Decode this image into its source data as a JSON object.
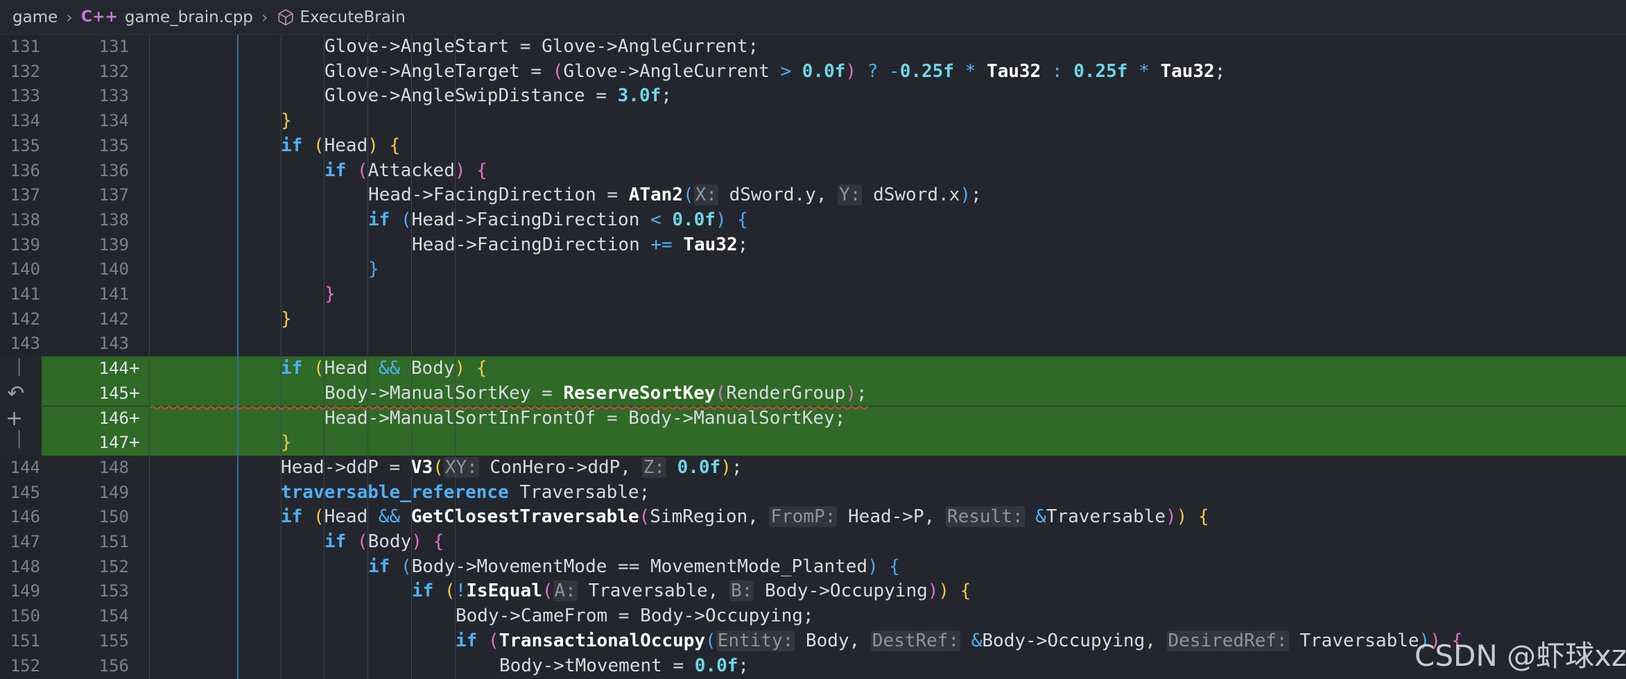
{
  "breadcrumb": {
    "folder": "game",
    "file_icon": "cpp-file-icon",
    "file": "game_brain.cpp",
    "symbol_icon": "cube-symbol-icon",
    "symbol": "ExecuteBrain"
  },
  "lines": [
    {
      "old": "131",
      "new": "131",
      "mark": "",
      "added": false
    },
    {
      "old": "132",
      "new": "132",
      "mark": "",
      "added": false
    },
    {
      "old": "133",
      "new": "133",
      "mark": "",
      "added": false
    },
    {
      "old": "134",
      "new": "134",
      "mark": "",
      "added": false
    },
    {
      "old": "135",
      "new": "135",
      "mark": "",
      "added": false
    },
    {
      "old": "136",
      "new": "136",
      "mark": "",
      "added": false
    },
    {
      "old": "137",
      "new": "137",
      "mark": "",
      "added": false
    },
    {
      "old": "138",
      "new": "138",
      "mark": "",
      "added": false
    },
    {
      "old": "139",
      "new": "139",
      "mark": "",
      "added": false
    },
    {
      "old": "140",
      "new": "140",
      "mark": "",
      "added": false
    },
    {
      "old": "141",
      "new": "141",
      "mark": "",
      "added": false
    },
    {
      "old": "142",
      "new": "142",
      "mark": "",
      "added": false
    },
    {
      "old": "143",
      "new": "143",
      "mark": "",
      "added": false
    },
    {
      "old": "",
      "new": "144",
      "mark": "+",
      "added": true
    },
    {
      "old": "",
      "new": "145",
      "mark": "+",
      "added": true
    },
    {
      "old": "",
      "new": "146",
      "mark": "+",
      "added": true
    },
    {
      "old": "",
      "new": "147",
      "mark": "+",
      "added": true
    },
    {
      "old": "144",
      "new": "148",
      "mark": "",
      "added": false
    },
    {
      "old": "145",
      "new": "149",
      "mark": "",
      "added": false
    },
    {
      "old": "146",
      "new": "150",
      "mark": "",
      "added": false
    },
    {
      "old": "147",
      "new": "151",
      "mark": "",
      "added": false
    },
    {
      "old": "148",
      "new": "152",
      "mark": "",
      "added": false
    },
    {
      "old": "149",
      "new": "153",
      "mark": "",
      "added": false
    },
    {
      "old": "150",
      "new": "154",
      "mark": "",
      "added": false
    },
    {
      "old": "151",
      "new": "155",
      "mark": "",
      "added": false
    },
    {
      "old": "152",
      "new": "156",
      "mark": "",
      "added": false
    }
  ],
  "code": [
    [
      {
        "t": "Glove->AngleStart = Glove->AngleCurrent;",
        "c": ""
      }
    ],
    [
      {
        "t": "Glove->AngleTarget = ",
        "c": ""
      },
      {
        "t": "(",
        "c": "b2"
      },
      {
        "t": "Glove->AngleCurrent ",
        "c": ""
      },
      {
        "t": ">",
        "c": "op"
      },
      {
        "t": " ",
        "c": ""
      },
      {
        "t": "0.0f",
        "c": "num"
      },
      {
        "t": ")",
        "c": "b2"
      },
      {
        "t": " ? -",
        "c": "op"
      },
      {
        "t": "0.25f",
        "c": "num"
      },
      {
        "t": " * ",
        "c": "op"
      },
      {
        "t": "Tau32",
        "c": "fn"
      },
      {
        "t": " : ",
        "c": "op"
      },
      {
        "t": "0.25f",
        "c": "num"
      },
      {
        "t": " * ",
        "c": "op"
      },
      {
        "t": "Tau32",
        "c": "fn"
      },
      {
        "t": ";",
        "c": ""
      }
    ],
    [
      {
        "t": "Glove->AngleSwipDistance = ",
        "c": ""
      },
      {
        "t": "3.0f",
        "c": "num"
      },
      {
        "t": ";",
        "c": ""
      }
    ],
    [
      {
        "t": "}",
        "c": "b1"
      }
    ],
    [
      {
        "t": "if",
        "c": "kw"
      },
      {
        "t": " ",
        "c": ""
      },
      {
        "t": "(",
        "c": "b1"
      },
      {
        "t": "Head",
        "c": ""
      },
      {
        "t": ")",
        "c": "b1"
      },
      {
        "t": " ",
        "c": ""
      },
      {
        "t": "{",
        "c": "b1"
      }
    ],
    [
      {
        "t": "if",
        "c": "kw"
      },
      {
        "t": " ",
        "c": ""
      },
      {
        "t": "(",
        "c": "b2"
      },
      {
        "t": "Attacked",
        "c": ""
      },
      {
        "t": ")",
        "c": "b2"
      },
      {
        "t": " ",
        "c": ""
      },
      {
        "t": "{",
        "c": "b2"
      }
    ],
    [
      {
        "t": "Head->FacingDirection = ",
        "c": ""
      },
      {
        "t": "ATan2",
        "c": "fn"
      },
      {
        "t": "(",
        "c": "b3"
      },
      {
        "t": "X:",
        "c": "hint"
      },
      {
        "t": " dSword.y, ",
        "c": ""
      },
      {
        "t": "Y:",
        "c": "hint"
      },
      {
        "t": " dSword.x",
        "c": ""
      },
      {
        "t": ")",
        "c": "b3"
      },
      {
        "t": ";",
        "c": ""
      }
    ],
    [
      {
        "t": "if",
        "c": "kw"
      },
      {
        "t": " ",
        "c": ""
      },
      {
        "t": "(",
        "c": "b3"
      },
      {
        "t": "Head->FacingDirection ",
        "c": ""
      },
      {
        "t": "<",
        "c": "op"
      },
      {
        "t": " ",
        "c": ""
      },
      {
        "t": "0.0f",
        "c": "num"
      },
      {
        "t": ")",
        "c": "b3"
      },
      {
        "t": " ",
        "c": ""
      },
      {
        "t": "{",
        "c": "b3"
      }
    ],
    [
      {
        "t": "Head->FacingDirection ",
        "c": ""
      },
      {
        "t": "+=",
        "c": "op"
      },
      {
        "t": " ",
        "c": ""
      },
      {
        "t": "Tau32",
        "c": "fn"
      },
      {
        "t": ";",
        "c": ""
      }
    ],
    [
      {
        "t": "}",
        "c": "b3"
      }
    ],
    [
      {
        "t": "}",
        "c": "b2"
      }
    ],
    [
      {
        "t": "}",
        "c": "b1"
      }
    ],
    [],
    [
      {
        "t": "if",
        "c": "kw"
      },
      {
        "t": " ",
        "c": ""
      },
      {
        "t": "(",
        "c": "b1"
      },
      {
        "t": "Head ",
        "c": ""
      },
      {
        "t": "&&",
        "c": "op"
      },
      {
        "t": " Body",
        "c": ""
      },
      {
        "t": ")",
        "c": "b1"
      },
      {
        "t": " ",
        "c": ""
      },
      {
        "t": "{",
        "c": "b1"
      }
    ],
    [
      {
        "t": "Body->ManualSortKey = ",
        "c": ""
      },
      {
        "t": "ReserveSortKey",
        "c": "fn"
      },
      {
        "t": "(",
        "c": "b2"
      },
      {
        "t": "RenderGroup",
        "c": ""
      },
      {
        "t": ")",
        "c": "b2"
      },
      {
        "t": ";",
        "c": ""
      }
    ],
    [
      {
        "t": "Head->ManualSortInFrontOf = Body->ManualSortKey;",
        "c": ""
      }
    ],
    [
      {
        "t": "}",
        "c": "b1"
      }
    ],
    [
      {
        "t": "Head->ddP = ",
        "c": ""
      },
      {
        "t": "V3",
        "c": "fn"
      },
      {
        "t": "(",
        "c": "b1"
      },
      {
        "t": "XY:",
        "c": "hint"
      },
      {
        "t": " ConHero->ddP, ",
        "c": ""
      },
      {
        "t": "Z:",
        "c": "hint"
      },
      {
        "t": " ",
        "c": ""
      },
      {
        "t": "0.0f",
        "c": "num"
      },
      {
        "t": ")",
        "c": "b1"
      },
      {
        "t": ";",
        "c": ""
      }
    ],
    [
      {
        "t": "traversable_reference",
        "c": "ty"
      },
      {
        "t": " Traversable;",
        "c": ""
      }
    ],
    [
      {
        "t": "if",
        "c": "kw"
      },
      {
        "t": " ",
        "c": ""
      },
      {
        "t": "(",
        "c": "b1"
      },
      {
        "t": "Head ",
        "c": ""
      },
      {
        "t": "&&",
        "c": "op"
      },
      {
        "t": " ",
        "c": ""
      },
      {
        "t": "GetClosestTraversable",
        "c": "fn"
      },
      {
        "t": "(",
        "c": "b2"
      },
      {
        "t": "SimRegion, ",
        "c": ""
      },
      {
        "t": "FromP:",
        "c": "hint"
      },
      {
        "t": " Head->P, ",
        "c": ""
      },
      {
        "t": "Result:",
        "c": "hint"
      },
      {
        "t": " ",
        "c": ""
      },
      {
        "t": "&",
        "c": "op"
      },
      {
        "t": "Traversable",
        "c": ""
      },
      {
        "t": ")",
        "c": "b2"
      },
      {
        "t": ")",
        "c": "b1"
      },
      {
        "t": " ",
        "c": ""
      },
      {
        "t": "{",
        "c": "b1"
      }
    ],
    [
      {
        "t": "if",
        "c": "kw"
      },
      {
        "t": " ",
        "c": ""
      },
      {
        "t": "(",
        "c": "b2"
      },
      {
        "t": "Body",
        "c": ""
      },
      {
        "t": ")",
        "c": "b2"
      },
      {
        "t": " ",
        "c": ""
      },
      {
        "t": "{",
        "c": "b2"
      }
    ],
    [
      {
        "t": "if",
        "c": "kw"
      },
      {
        "t": " ",
        "c": ""
      },
      {
        "t": "(",
        "c": "b3"
      },
      {
        "t": "Body->MovementMode == MovementMode_Planted",
        "c": ""
      },
      {
        "t": ")",
        "c": "b3"
      },
      {
        "t": " ",
        "c": ""
      },
      {
        "t": "{",
        "c": "b3"
      }
    ],
    [
      {
        "t": "if",
        "c": "kw"
      },
      {
        "t": " ",
        "c": ""
      },
      {
        "t": "(",
        "c": "b1"
      },
      {
        "t": "!",
        "c": "op"
      },
      {
        "t": "IsEqual",
        "c": "fn"
      },
      {
        "t": "(",
        "c": "b2"
      },
      {
        "t": "A:",
        "c": "hint"
      },
      {
        "t": " Traversable, ",
        "c": ""
      },
      {
        "t": "B:",
        "c": "hint"
      },
      {
        "t": " Body->Occupying",
        "c": ""
      },
      {
        "t": ")",
        "c": "b2"
      },
      {
        "t": ")",
        "c": "b1"
      },
      {
        "t": " ",
        "c": ""
      },
      {
        "t": "{",
        "c": "b1"
      }
    ],
    [
      {
        "t": "Body->CameFrom = Body->Occupying;",
        "c": ""
      }
    ],
    [
      {
        "t": "if",
        "c": "kw"
      },
      {
        "t": " ",
        "c": ""
      },
      {
        "t": "(",
        "c": "b2"
      },
      {
        "t": "TransactionalOccupy",
        "c": "fn"
      },
      {
        "t": "(",
        "c": "b3"
      },
      {
        "t": "Entity:",
        "c": "hint"
      },
      {
        "t": " Body, ",
        "c": ""
      },
      {
        "t": "DestRef:",
        "c": "hint"
      },
      {
        "t": " ",
        "c": ""
      },
      {
        "t": "&",
        "c": "op"
      },
      {
        "t": "Body->Occupying, ",
        "c": ""
      },
      {
        "t": "DesiredRef:",
        "c": "hint"
      },
      {
        "t": " Traversable",
        "c": ""
      },
      {
        "t": ")",
        "c": "b3"
      },
      {
        "t": ")",
        "c": "b2"
      },
      {
        "t": " ",
        "c": ""
      },
      {
        "t": "{",
        "c": "b2"
      }
    ],
    [
      {
        "t": "Body->tMovement = ",
        "c": ""
      },
      {
        "t": "0.0f",
        "c": "num"
      },
      {
        "t": ";",
        "c": ""
      }
    ]
  ],
  "indent": [
    7,
    7,
    7,
    6,
    6,
    7,
    8,
    8,
    9,
    8,
    7,
    6,
    6,
    6,
    7,
    7,
    6,
    6,
    6,
    6,
    7,
    8,
    9,
    10,
    10,
    11
  ],
  "gutter_icons": {
    "revert": "revert-change-icon",
    "add": "add-line-icon"
  },
  "watermark": "CSDN @虾球xz"
}
